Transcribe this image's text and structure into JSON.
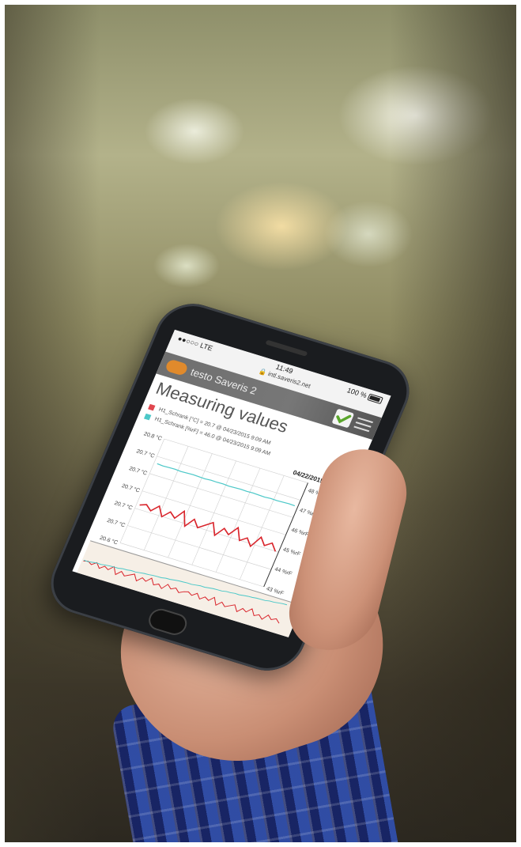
{
  "status_bar": {
    "carrier": "●●○○○  LTE",
    "time": "11:49",
    "url": "🔒 intl.saveris2.net",
    "battery": "100 %"
  },
  "app_bar": {
    "title": "testo Saveris 2"
  },
  "page": {
    "title": "Measuring values"
  },
  "legend": [
    {
      "label": "H1_Schrank [°C] = 20.7 @ 04/23/2015 9:09 AM",
      "color": "#e0464e"
    },
    {
      "label": "H1_Schrank [%rF] = 46.0 @ 04/23/2015 9:09 AM",
      "color": "#4cc8c8"
    }
  ],
  "chart_data": {
    "type": "line",
    "title": "",
    "date_label": "04/22/2015 1:48 PM",
    "y_left_ticks": [
      "20.8 °C",
      "20.7 °C",
      "20.7 °C",
      "20.7 °C",
      "20.7 °C",
      "20.7 °C",
      "20.6 °C"
    ],
    "y_right_ticks": [
      "48 %rF",
      "47 %rF",
      "46 %rF",
      "45 %rF",
      "44 %rF",
      "43 %rF"
    ],
    "series": [
      {
        "name": "H1_Schrank [%rF]",
        "color": "#4cc8c8",
        "values": [
          46.9,
          46.8,
          46.85,
          46.9,
          46.8,
          46.85,
          46.9,
          46.85,
          46.8,
          46.9,
          46.85,
          46.9,
          46.8,
          46.85,
          46.9,
          46.85,
          46.9,
          46.85,
          46.8,
          46.9,
          46.85,
          46.9,
          46.95,
          46.9
        ]
      },
      {
        "name": "H1_Schrank [°C]",
        "color": "#d9252c",
        "values": [
          20.69,
          20.7,
          20.68,
          20.71,
          20.67,
          20.7,
          20.68,
          20.72,
          20.66,
          20.7,
          20.67,
          20.69,
          20.71,
          20.66,
          20.7,
          20.68,
          20.72,
          20.67,
          20.69,
          20.66,
          20.71,
          20.68,
          20.7,
          20.67
        ]
      }
    ],
    "grid": true
  }
}
